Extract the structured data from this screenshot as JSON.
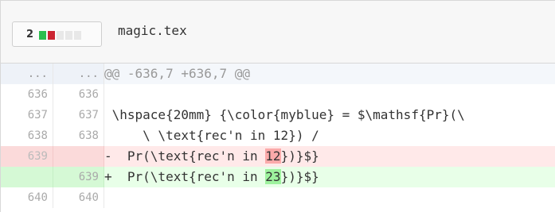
{
  "file": {
    "name": "magic.tex",
    "change_count": "2",
    "stat_colors": [
      "#2cbe4e",
      "#cb2431",
      "#e8e8e8",
      "#e8e8e8",
      "#e8e8e8"
    ]
  },
  "diff": {
    "hunk": {
      "old": "...",
      "new": "...",
      "text": "@@ -636,7 +636,7 @@"
    },
    "lines": [
      {
        "type": "ctx",
        "old": "636",
        "new": "636",
        "pre": "",
        "hl": "",
        "post": ""
      },
      {
        "type": "ctx",
        "old": "637",
        "new": "637",
        "pre": " \\hspace{20mm} {\\color{myblue} = $\\mathsf{Pr}(\\",
        "hl": "",
        "post": ""
      },
      {
        "type": "ctx",
        "old": "638",
        "new": "638",
        "pre": "     \\ \\text{rec'n in 12}) /",
        "hl": "",
        "post": ""
      },
      {
        "type": "del",
        "old": "639",
        "new": "",
        "pre": "-  Pr(\\text{rec'n in ",
        "hl": "12",
        "post": "})}$}"
      },
      {
        "type": "add",
        "old": "",
        "new": "639",
        "pre": "+  Pr(\\text{rec'n in ",
        "hl": "23",
        "post": "})}$}"
      },
      {
        "type": "ctx",
        "old": "640",
        "new": "640",
        "pre": "",
        "hl": "",
        "post": ""
      }
    ]
  }
}
